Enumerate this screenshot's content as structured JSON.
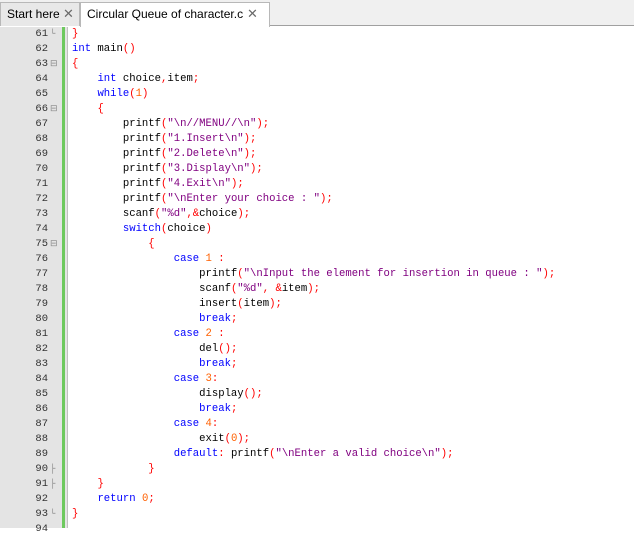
{
  "tabs": [
    {
      "label": "Start here",
      "close_glyph": "✕",
      "active": false
    },
    {
      "label": "Circular Queue of character.c",
      "close_glyph": "✕",
      "active": true
    }
  ],
  "editor": {
    "lines": [
      {
        "n": "61",
        "fold": "└",
        "tokens": [
          [
            "br",
            "}"
          ]
        ]
      },
      {
        "n": "62",
        "fold": "",
        "tokens": [
          [
            "kw",
            "int"
          ],
          [
            "t",
            " main"
          ],
          [
            "br",
            "()"
          ]
        ]
      },
      {
        "n": "63",
        "fold": "⊟",
        "tokens": [
          [
            "br",
            "{"
          ]
        ]
      },
      {
        "n": "64",
        "fold": "",
        "tokens": [
          [
            "t",
            "    "
          ],
          [
            "kw",
            "int"
          ],
          [
            "t",
            " choice"
          ],
          [
            "op",
            ","
          ],
          [
            "t",
            "item"
          ],
          [
            "op",
            ";"
          ]
        ]
      },
      {
        "n": "65",
        "fold": "",
        "tokens": [
          [
            "t",
            "    "
          ],
          [
            "kw",
            "while"
          ],
          [
            "br",
            "("
          ],
          [
            "num",
            "1"
          ],
          [
            "br",
            ")"
          ]
        ]
      },
      {
        "n": "66",
        "fold": "⊟",
        "tokens": [
          [
            "t",
            "    "
          ],
          [
            "br",
            "{"
          ]
        ]
      },
      {
        "n": "67",
        "fold": "",
        "tokens": [
          [
            "t",
            "        printf"
          ],
          [
            "br",
            "("
          ],
          [
            "str",
            "\"\\n//MENU//\\n\""
          ],
          [
            "br",
            ")"
          ],
          [
            "op",
            ";"
          ]
        ]
      },
      {
        "n": "68",
        "fold": "",
        "tokens": [
          [
            "t",
            "        printf"
          ],
          [
            "br",
            "("
          ],
          [
            "str",
            "\"1.Insert\\n\""
          ],
          [
            "br",
            ")"
          ],
          [
            "op",
            ";"
          ]
        ]
      },
      {
        "n": "69",
        "fold": "",
        "tokens": [
          [
            "t",
            "        printf"
          ],
          [
            "br",
            "("
          ],
          [
            "str",
            "\"2.Delete\\n\""
          ],
          [
            "br",
            ")"
          ],
          [
            "op",
            ";"
          ]
        ]
      },
      {
        "n": "70",
        "fold": "",
        "tokens": [
          [
            "t",
            "        printf"
          ],
          [
            "br",
            "("
          ],
          [
            "str",
            "\"3.Display\\n\""
          ],
          [
            "br",
            ")"
          ],
          [
            "op",
            ";"
          ]
        ]
      },
      {
        "n": "71",
        "fold": "",
        "tokens": [
          [
            "t",
            "        printf"
          ],
          [
            "br",
            "("
          ],
          [
            "str",
            "\"4.Exit\\n\""
          ],
          [
            "br",
            ")"
          ],
          [
            "op",
            ";"
          ]
        ]
      },
      {
        "n": "72",
        "fold": "",
        "tokens": [
          [
            "t",
            "        printf"
          ],
          [
            "br",
            "("
          ],
          [
            "str",
            "\"\\nEnter your choice : \""
          ],
          [
            "br",
            ")"
          ],
          [
            "op",
            ";"
          ]
        ]
      },
      {
        "n": "73",
        "fold": "",
        "tokens": [
          [
            "t",
            "        scanf"
          ],
          [
            "br",
            "("
          ],
          [
            "str",
            "\"%d\""
          ],
          [
            "op",
            ",&"
          ],
          [
            "t",
            "choice"
          ],
          [
            "br",
            ")"
          ],
          [
            "op",
            ";"
          ]
        ]
      },
      {
        "n": "74",
        "fold": "",
        "tokens": [
          [
            "t",
            "        "
          ],
          [
            "kw",
            "switch"
          ],
          [
            "br",
            "("
          ],
          [
            "t",
            "choice"
          ],
          [
            "br",
            ")"
          ]
        ]
      },
      {
        "n": "75",
        "fold": "⊟",
        "tokens": [
          [
            "t",
            "            "
          ],
          [
            "br",
            "{"
          ]
        ]
      },
      {
        "n": "76",
        "fold": "",
        "tokens": [
          [
            "t",
            "                "
          ],
          [
            "kw",
            "case"
          ],
          [
            "t",
            " "
          ],
          [
            "num",
            "1"
          ],
          [
            "t",
            " "
          ],
          [
            "op",
            ":"
          ]
        ]
      },
      {
        "n": "77",
        "fold": "",
        "tokens": [
          [
            "t",
            "                    printf"
          ],
          [
            "br",
            "("
          ],
          [
            "str",
            "\"\\nInput the element for insertion in queue : \""
          ],
          [
            "br",
            ")"
          ],
          [
            "op",
            ";"
          ]
        ]
      },
      {
        "n": "78",
        "fold": "",
        "tokens": [
          [
            "t",
            "                    scanf"
          ],
          [
            "br",
            "("
          ],
          [
            "str",
            "\"%d\""
          ],
          [
            "op",
            ", &"
          ],
          [
            "t",
            "item"
          ],
          [
            "br",
            ")"
          ],
          [
            "op",
            ";"
          ]
        ]
      },
      {
        "n": "79",
        "fold": "",
        "tokens": [
          [
            "t",
            "                    insert"
          ],
          [
            "br",
            "("
          ],
          [
            "t",
            "item"
          ],
          [
            "br",
            ")"
          ],
          [
            "op",
            ";"
          ]
        ]
      },
      {
        "n": "80",
        "fold": "",
        "tokens": [
          [
            "t",
            "                    "
          ],
          [
            "kw",
            "break"
          ],
          [
            "op",
            ";"
          ]
        ]
      },
      {
        "n": "81",
        "fold": "",
        "tokens": [
          [
            "t",
            "                "
          ],
          [
            "kw",
            "case"
          ],
          [
            "t",
            " "
          ],
          [
            "num",
            "2"
          ],
          [
            "t",
            " "
          ],
          [
            "op",
            ":"
          ]
        ]
      },
      {
        "n": "82",
        "fold": "",
        "tokens": [
          [
            "t",
            "                    del"
          ],
          [
            "br",
            "()"
          ],
          [
            "op",
            ";"
          ]
        ]
      },
      {
        "n": "83",
        "fold": "",
        "tokens": [
          [
            "t",
            "                    "
          ],
          [
            "kw",
            "break"
          ],
          [
            "op",
            ";"
          ]
        ]
      },
      {
        "n": "84",
        "fold": "",
        "tokens": [
          [
            "t",
            "                "
          ],
          [
            "kw",
            "case"
          ],
          [
            "t",
            " "
          ],
          [
            "num",
            "3"
          ],
          [
            "op",
            ":"
          ]
        ]
      },
      {
        "n": "85",
        "fold": "",
        "tokens": [
          [
            "t",
            "                    display"
          ],
          [
            "br",
            "()"
          ],
          [
            "op",
            ";"
          ]
        ]
      },
      {
        "n": "86",
        "fold": "",
        "tokens": [
          [
            "t",
            "                    "
          ],
          [
            "kw",
            "break"
          ],
          [
            "op",
            ";"
          ]
        ]
      },
      {
        "n": "87",
        "fold": "",
        "tokens": [
          [
            "t",
            "                "
          ],
          [
            "kw",
            "case"
          ],
          [
            "t",
            " "
          ],
          [
            "num",
            "4"
          ],
          [
            "op",
            ":"
          ]
        ]
      },
      {
        "n": "88",
        "fold": "",
        "tokens": [
          [
            "t",
            "                    exit"
          ],
          [
            "br",
            "("
          ],
          [
            "num",
            "0"
          ],
          [
            "br",
            ")"
          ],
          [
            "op",
            ";"
          ]
        ]
      },
      {
        "n": "89",
        "fold": "",
        "tokens": [
          [
            "t",
            "                "
          ],
          [
            "kw",
            "default"
          ],
          [
            "op",
            ":"
          ],
          [
            "t",
            " printf"
          ],
          [
            "br",
            "("
          ],
          [
            "str",
            "\"\\nEnter a valid choice\\n\""
          ],
          [
            "br",
            ")"
          ],
          [
            "op",
            ";"
          ]
        ]
      },
      {
        "n": "90",
        "fold": "├",
        "tokens": [
          [
            "t",
            "            "
          ],
          [
            "br",
            "}"
          ]
        ]
      },
      {
        "n": "91",
        "fold": "├",
        "tokens": [
          [
            "t",
            "    "
          ],
          [
            "br",
            "}"
          ]
        ]
      },
      {
        "n": "92",
        "fold": "",
        "tokens": [
          [
            "t",
            "    "
          ],
          [
            "kw",
            "return"
          ],
          [
            "t",
            " "
          ],
          [
            "num",
            "0"
          ],
          [
            "op",
            ";"
          ]
        ]
      },
      {
        "n": "93",
        "fold": "└",
        "tokens": [
          [
            "br",
            "}"
          ]
        ]
      },
      {
        "n": "94",
        "fold": "",
        "tokens": []
      }
    ]
  }
}
